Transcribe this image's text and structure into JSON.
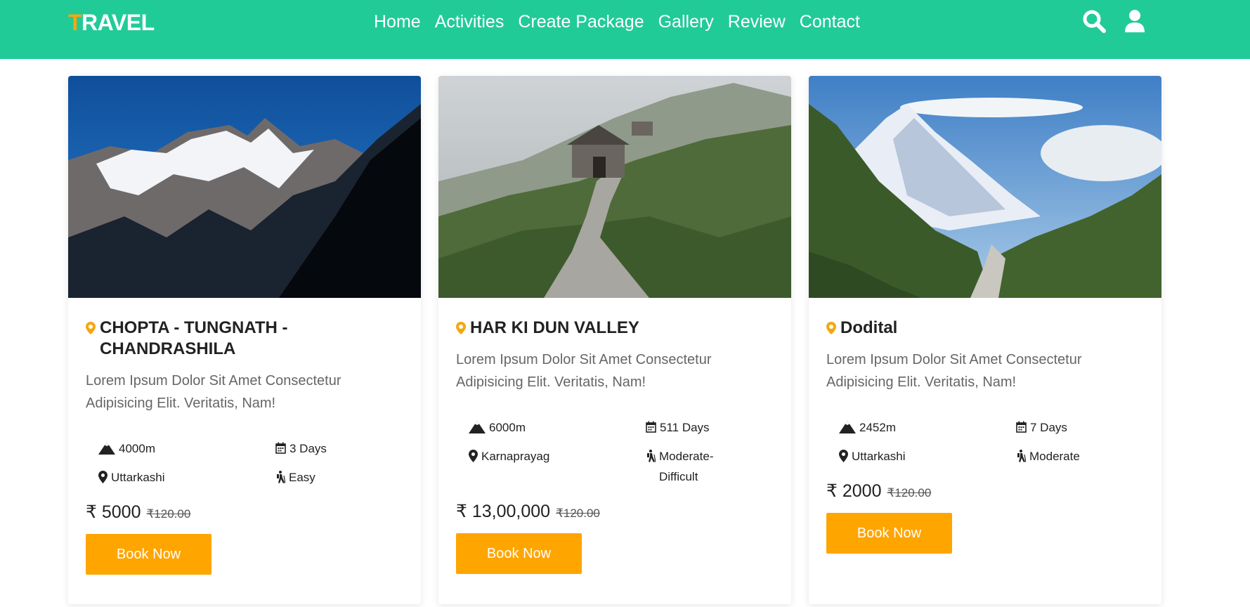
{
  "brand": {
    "first_letter": "T",
    "rest": "RAVEL",
    "accent": "#f6a70e",
    "nav_bg": "#21cb98"
  },
  "nav": {
    "items": [
      "Home",
      "Activities",
      "Create Package",
      "Gallery",
      "Review",
      "Contact"
    ],
    "icons": [
      "search-icon",
      "user-icon"
    ]
  },
  "cards": [
    {
      "title": "CHOPTA - TUNGNATH - CHANDRASHILA",
      "description": "Lorem Ipsum Dolor Sit Amet Consectetur Adipisicing Elit. Veritatis, Nam!",
      "altitude": "4000m",
      "duration": "3 Days",
      "location": "Uttarkashi",
      "difficulty": "Easy",
      "price": "₹ 5000",
      "old_price": "₹120.00",
      "button": "Book Now"
    },
    {
      "title": "HAR KI DUN VALLEY",
      "description": "Lorem Ipsum Dolor Sit Amet Consectetur Adipisicing Elit. Veritatis, Nam!",
      "altitude": "6000m",
      "duration": "511 Days",
      "location": "Karnaprayag",
      "difficulty": "Moderate-Difficult",
      "price": "₹ 13,00,000",
      "old_price": "₹120.00",
      "button": "Book Now"
    },
    {
      "title": "Dodital",
      "description": "Lorem Ipsum Dolor Sit Amet Consectetur Adipisicing Elit. Veritatis, Nam!",
      "altitude": "2452m",
      "duration": "7 Days",
      "location": "Uttarkashi",
      "difficulty": "Moderate",
      "price": "₹ 2000",
      "old_price": "₹120.00",
      "button": "Book Now"
    }
  ],
  "colors": {
    "button": "#ffa500",
    "pin": "#f6a70e"
  }
}
